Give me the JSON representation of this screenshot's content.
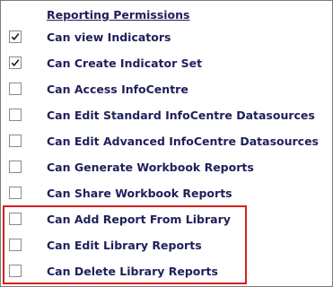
{
  "header": {
    "title": "Reporting Permissions"
  },
  "permissions": [
    {
      "label": "Can view Indicators",
      "checked": true
    },
    {
      "label": "Can Create Indicator Set",
      "checked": true
    },
    {
      "label": "Can Access InfoCentre",
      "checked": false
    },
    {
      "label": "Can Edit Standard InfoCentre Datasources",
      "checked": false
    },
    {
      "label": "Can Edit Advanced InfoCentre Datasources",
      "checked": false
    },
    {
      "label": "Can Generate Workbook Reports",
      "checked": false
    },
    {
      "label": "Can Share Workbook Reports",
      "checked": false
    },
    {
      "label": "Can Add Report From Library",
      "checked": false
    },
    {
      "label": "Can Edit Library Reports",
      "checked": false
    },
    {
      "label": "Can Delete Library Reports",
      "checked": false
    }
  ],
  "colors": {
    "label_text": "#1f1f5c",
    "highlight": "#d41f1f",
    "checkbox_border": "#8a8a8a"
  }
}
